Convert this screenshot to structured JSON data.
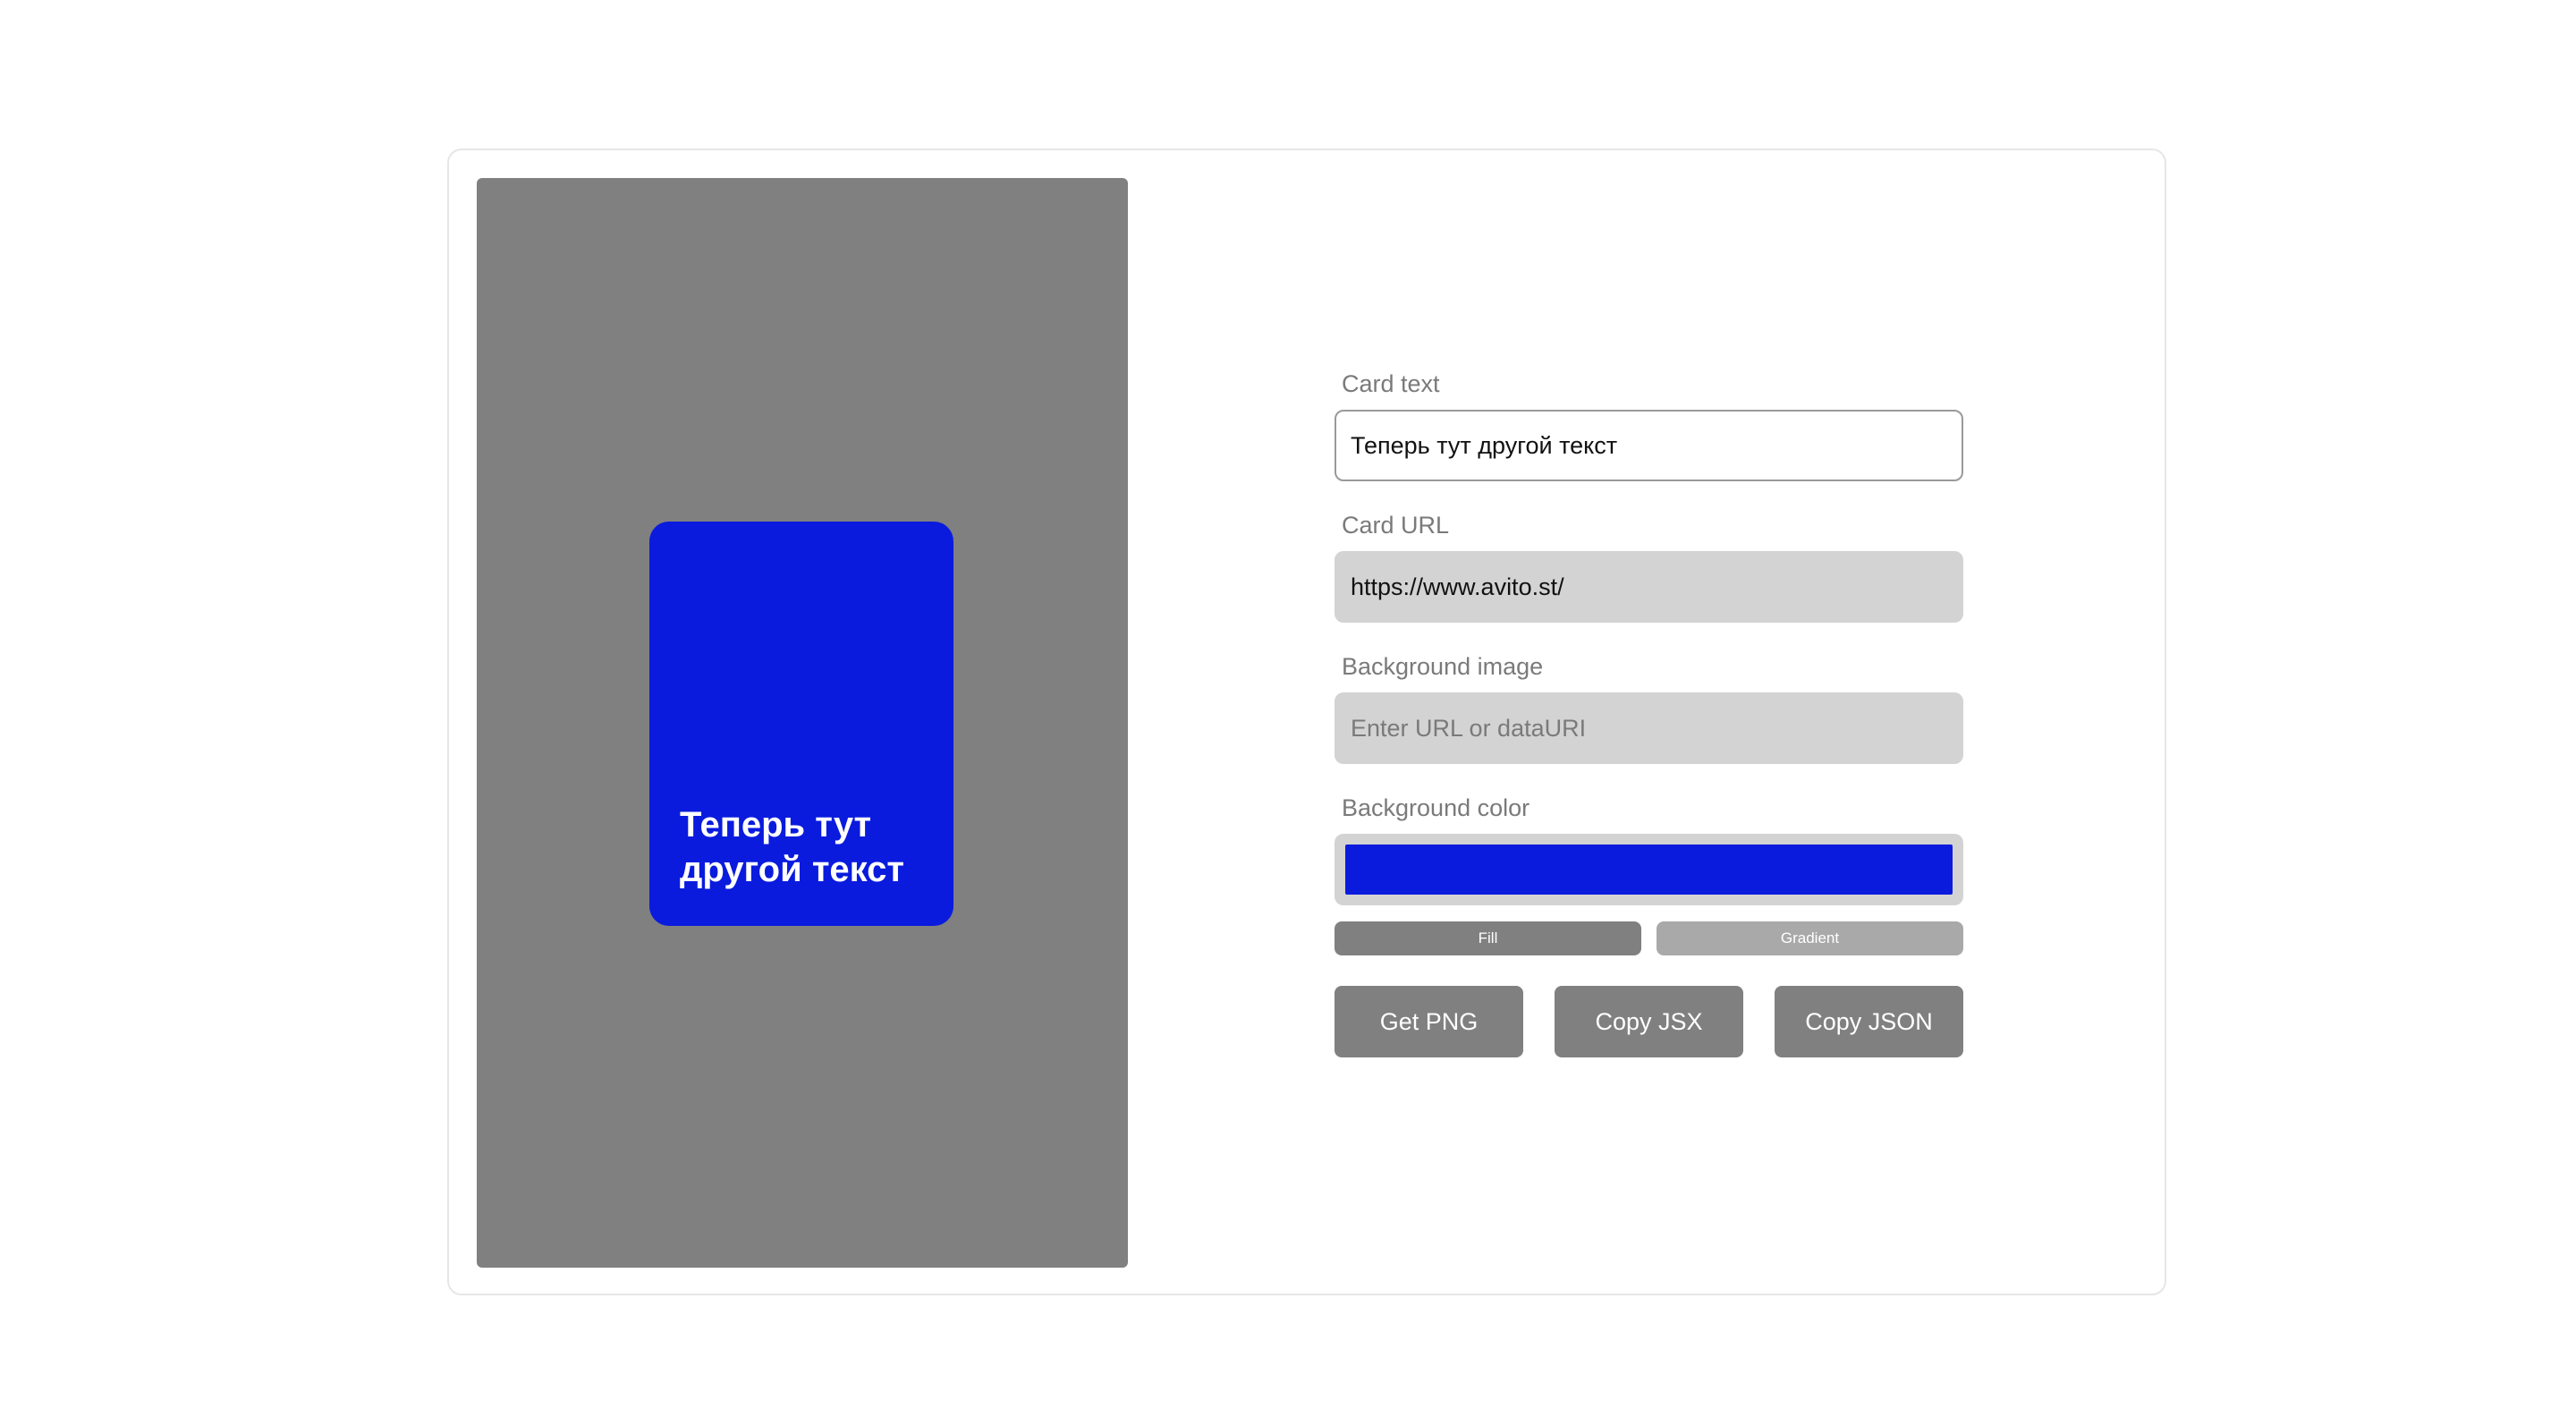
{
  "preview": {
    "card_text": "Теперь тут другой текст",
    "card_color": "#0a1bde",
    "panel_color": "#808080"
  },
  "form": {
    "card_text": {
      "label": "Card text",
      "value": "Теперь тут другой текст"
    },
    "card_url": {
      "label": "Card URL",
      "value": "https://www.avito.st/"
    },
    "background_image": {
      "label": "Background image",
      "value": "",
      "placeholder": "Enter URL or dataURI"
    },
    "background_color": {
      "label": "Background color",
      "value": "#0a1bde"
    },
    "modes": {
      "fill_label": "Fill",
      "gradient_label": "Gradient",
      "selected": "Fill"
    },
    "actions": {
      "get_png_label": "Get PNG",
      "copy_jsx_label": "Copy JSX",
      "copy_json_label": "Copy JSON"
    }
  }
}
